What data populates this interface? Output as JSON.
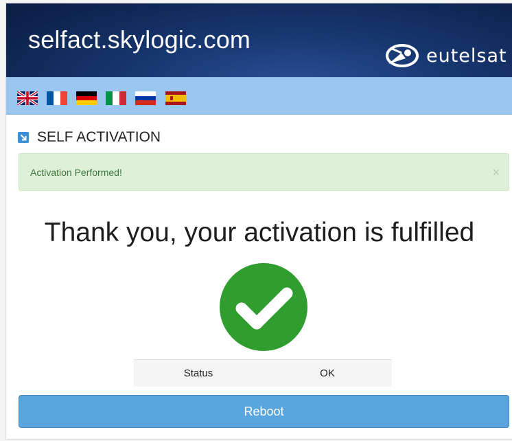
{
  "header": {
    "site_title": "selfact.skylogic.com",
    "brand_name": "eutelsat"
  },
  "languages": [
    {
      "code": "en",
      "icon": "uk-flag-icon"
    },
    {
      "code": "fr",
      "icon": "france-flag-icon"
    },
    {
      "code": "de",
      "icon": "germany-flag-icon"
    },
    {
      "code": "it",
      "icon": "italy-flag-icon"
    },
    {
      "code": "ru",
      "icon": "russia-flag-icon"
    },
    {
      "code": "es",
      "icon": "spain-flag-icon"
    }
  ],
  "section": {
    "title": "SELF ACTIVATION",
    "icon": "arrow-down-right-icon"
  },
  "alert": {
    "message": "Activation Performed!",
    "close_symbol": "×"
  },
  "main": {
    "headline": "Thank you, your activation is fulfilled",
    "status_label": "Status",
    "status_value": "OK",
    "reboot_label": "Reboot"
  },
  "colors": {
    "header_dark": "#0c1f47",
    "flagbar": "#9ac7ef",
    "success_green": "#2f9e2f",
    "alert_bg": "#dff0d8",
    "alert_text": "#3c763d",
    "button_blue": "#59a6de"
  }
}
